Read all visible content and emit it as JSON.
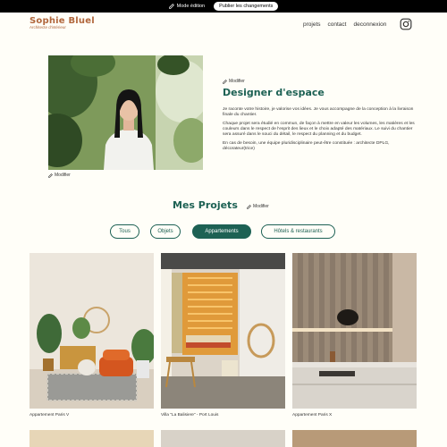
{
  "edit_bar": {
    "mode_label": "Mode édition",
    "publish_label": "Publier les changements"
  },
  "header": {
    "logo_name": "Sophie Bluel",
    "logo_sub": "Architecte d'intérieur",
    "nav": [
      "projets",
      "contact",
      "deconnexion"
    ]
  },
  "intro": {
    "photo_modify": "Modifier",
    "text_modify": "Modifier",
    "title": "Designer d'espace",
    "paragraphs": [
      "Je raconte votre histoire, je valorise vos idées. Je vous accompagne de la conception à la livraison finale du chantier.",
      "Chaque projet sera étudié en commun, de façon à mettre en valeur les volumes, les matières et les couleurs dans le respect de l'esprit des lieux et le choix adapté des matériaux. Le suivi du chantier sera assuré dans le souci du détail, le respect du planning et du budget.",
      "En cas de besoin, une équipe pluridisciplinaire peut-être constituée : architecte DPLG, décorateur(trice)"
    ]
  },
  "projects": {
    "title": "Mes Projets",
    "modify": "Modifier",
    "filters": [
      "Tous",
      "Objets",
      "Appartements",
      "Hôtels & restaurants"
    ],
    "active_filter": "Appartements",
    "cards": [
      {
        "caption": "Appartement Paris V"
      },
      {
        "caption": "Villa “La Balisiere” - Port Louis"
      },
      {
        "caption": "Appartement Paris X"
      }
    ]
  },
  "colors": {
    "accent": "#1d6154",
    "logo": "#b1663c",
    "bar": "#000000"
  },
  "icons": [
    "edit-icon",
    "instagram-icon"
  ]
}
